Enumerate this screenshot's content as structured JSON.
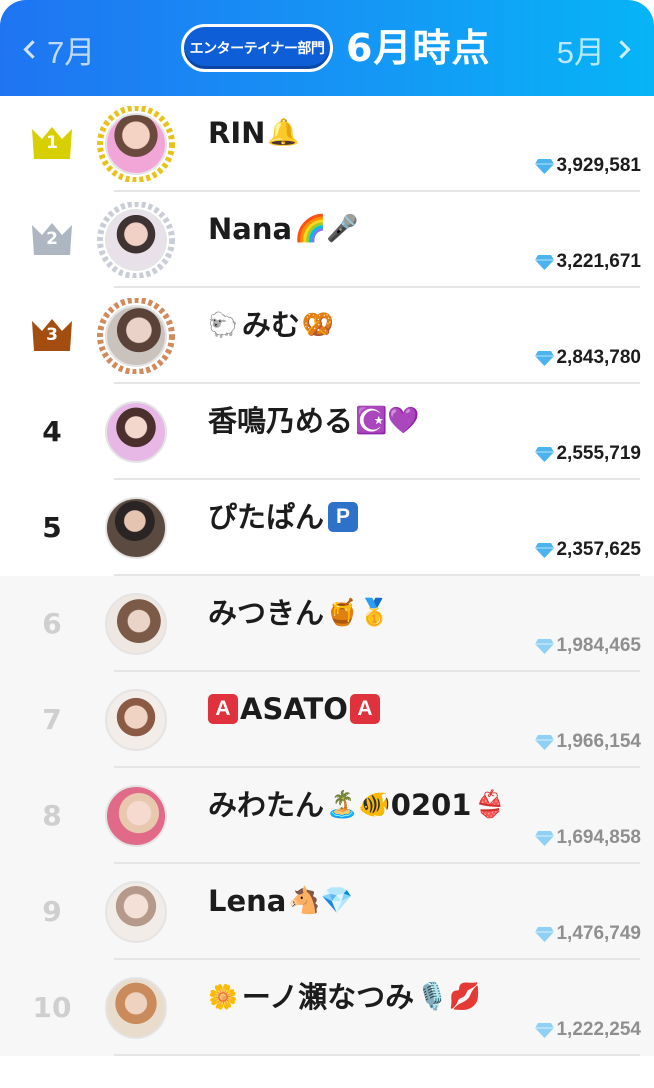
{
  "header": {
    "prev_label": "7月",
    "category": "エンターテイナー部門",
    "title": "6月時点",
    "next_label": "5月"
  },
  "colors": {
    "header_start": "#1f74f2",
    "header_end": "#07b4f6",
    "gold": "#d8cf00",
    "silver": "#aeb6c2",
    "bronze": "#a44d10",
    "gem": "#4ab4f0",
    "dim_rank": "#cfcfcf"
  },
  "ranking": [
    {
      "rank": "1",
      "name": "RIN",
      "emoji": "🔔",
      "score": "3,929,581"
    },
    {
      "rank": "2",
      "name": "Nana",
      "emoji": "🌈🎤",
      "score": "3,221,671"
    },
    {
      "rank": "3",
      "pre": "🐑",
      "name": "みむ",
      "emoji": "🥨",
      "score": "2,843,780"
    },
    {
      "rank": "4",
      "name": "香鳴乃める",
      "emoji": "☪️💜",
      "score": "2,555,719"
    },
    {
      "rank": "5",
      "name": "ぴたぱん",
      "tag": "P",
      "score": "2,357,625"
    },
    {
      "rank": "6",
      "name": "みつきん",
      "emoji": "🍯🥇",
      "score": "1,984,465"
    },
    {
      "rank": "7",
      "tag_pre": "A",
      "name": "ASATO",
      "tag": "A",
      "score": "1,966,154"
    },
    {
      "rank": "8",
      "name": "みわたん",
      "emoji": "🏝️🐠",
      "name_suffix": "0201",
      "emoji2": "👙",
      "score": "1,694,858"
    },
    {
      "rank": "9",
      "name": "Lena",
      "emoji": "🐴💎",
      "score": "1,476,749"
    },
    {
      "rank": "10",
      "pre": "🌼",
      "name": "ーノ瀬なつみ",
      "emoji": "🎙️💋",
      "score": "1,222,254"
    }
  ]
}
